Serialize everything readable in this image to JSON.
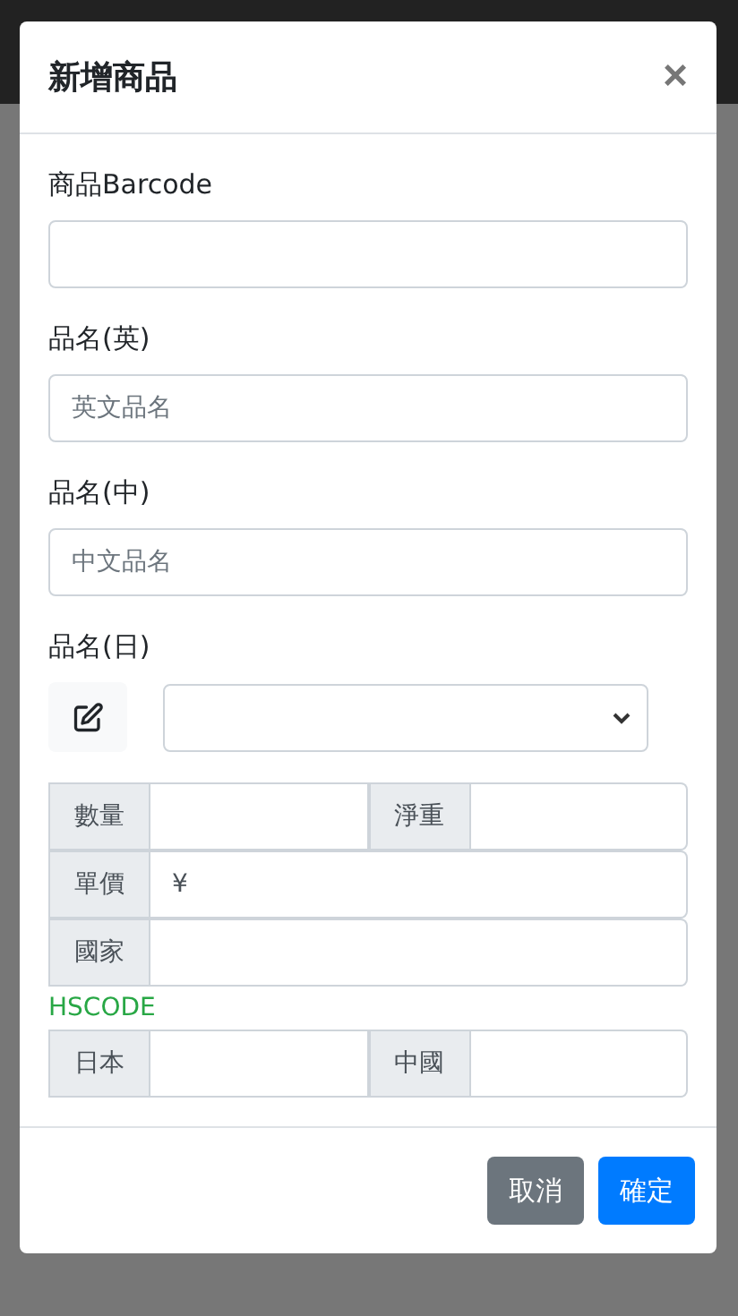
{
  "modal": {
    "title": "新增商品",
    "close": "×"
  },
  "fields": [
    {
      "kind": "text",
      "label": "商品Barcode"
    },
    {
      "kind": "text",
      "label": "品名(英)",
      "placeholder": "英文品名"
    },
    {
      "kind": "text",
      "label": "品名(中)",
      "placeholder": "中文品名"
    },
    {
      "kind": "select",
      "label": "品名(日)"
    }
  ],
  "groups": [
    {
      "kind": "row",
      "cells": [
        {
          "addon": "數量"
        },
        {
          "addon": "淨重"
        }
      ]
    },
    {
      "kind": "row",
      "cells": [
        {
          "addon": "單價",
          "value": "¥"
        }
      ]
    },
    {
      "kind": "row",
      "cells": [
        {
          "addon": "國家"
        }
      ]
    },
    {
      "kind": "heading",
      "text": "HSCODE"
    },
    {
      "kind": "row",
      "cells": [
        {
          "addon": "日本"
        },
        {
          "addon": "中國"
        }
      ]
    }
  ],
  "buttons": [
    {
      "label": "取消",
      "kind": "secondary"
    },
    {
      "label": "確定",
      "kind": "primary"
    }
  ]
}
